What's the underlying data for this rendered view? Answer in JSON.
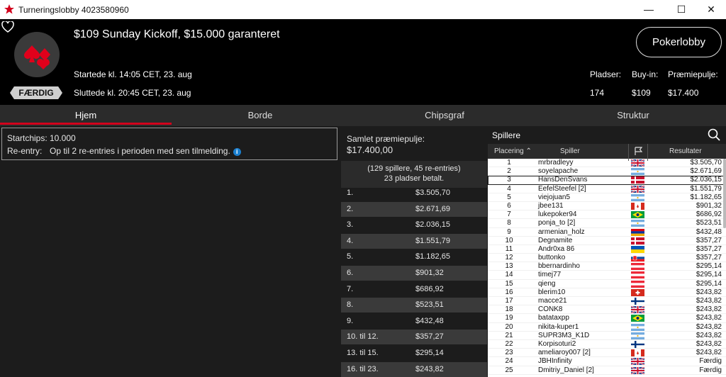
{
  "window": {
    "title": "Turneringslobby 4023580960"
  },
  "header": {
    "tournament_name": "$109 Sunday Kickoff, $15.000 garanteret",
    "status_badge": "FÆRDIG",
    "started": "Startede kl. 14:05 CET, 23. aug",
    "ended": "Sluttede kl. 20:45 CET, 23. aug",
    "pokerlobby_button": "Pokerlobby",
    "stats": {
      "seats_label": "Pladser:",
      "seats_value": "174",
      "buyin_label": "Buy-in:",
      "buyin_value": "$109",
      "prizepool_label": "Præmiepulje:",
      "prizepool_value": "$17.400"
    }
  },
  "tabs": [
    {
      "label": "Hjem"
    },
    {
      "label": "Borde"
    },
    {
      "label": "Chipsgraf"
    },
    {
      "label": "Struktur"
    }
  ],
  "info": {
    "startchips_label": "Startchips:",
    "startchips_value": "10.000",
    "reentry_label": "Re-entry:",
    "reentry_value": "Op til 2 re-entries i perioden med sen tilmelding."
  },
  "prizes": {
    "title_line1": "Samlet præmiepulje:",
    "title_line2": "$17.400,00",
    "summary_line1": "(129 spillere, 45 re-entries)",
    "summary_line2": "23 pladser betalt.",
    "rows": [
      {
        "place": "1.",
        "amount": "$3.505,70"
      },
      {
        "place": "2.",
        "amount": "$2.671,69"
      },
      {
        "place": "3.",
        "amount": "$2.036,15"
      },
      {
        "place": "4.",
        "amount": "$1.551,79"
      },
      {
        "place": "5.",
        "amount": "$1.182,65"
      },
      {
        "place": "6.",
        "amount": "$901,32"
      },
      {
        "place": "7.",
        "amount": "$686,92"
      },
      {
        "place": "8.",
        "amount": "$523,51"
      },
      {
        "place": "9.",
        "amount": "$432,48"
      },
      {
        "place": "10. til 12.",
        "amount": "$357,27"
      },
      {
        "place": "13. til 15.",
        "amount": "$295,14"
      },
      {
        "place": "16. til 23.",
        "amount": "$243,82"
      }
    ]
  },
  "players": {
    "title": "Spillere",
    "col_place": "Placering",
    "col_player": "Spiller",
    "col_result": "Resultater",
    "rows": [
      {
        "rank": "1",
        "name": "mrbradleyy",
        "flag": "gb",
        "result": "$3.505,70"
      },
      {
        "rank": "2",
        "name": "soyelapache",
        "flag": "ar",
        "result": "$2.671,69"
      },
      {
        "rank": "3",
        "name": "HansDenSvans",
        "flag": "dk",
        "result": "$2.036,15"
      },
      {
        "rank": "4",
        "name": "EefelSteefel [2]",
        "flag": "gb",
        "result": "$1.551,79"
      },
      {
        "rank": "5",
        "name": "viejojuan5",
        "flag": "ar",
        "result": "$1.182,65"
      },
      {
        "rank": "6",
        "name": "jbee131",
        "flag": "ca",
        "result": "$901,32"
      },
      {
        "rank": "7",
        "name": "lukepoker94",
        "flag": "br",
        "result": "$686,92"
      },
      {
        "rank": "8",
        "name": "ponja_to [2]",
        "flag": "ar",
        "result": "$523,51"
      },
      {
        "rank": "9",
        "name": "armenian_holz",
        "flag": "am",
        "result": "$432,48"
      },
      {
        "rank": "10",
        "name": "Degnamite",
        "flag": "dk",
        "result": "$357,27"
      },
      {
        "rank": "11",
        "name": "Andr0xa 86",
        "flag": "ua",
        "result": "$357,27"
      },
      {
        "rank": "12",
        "name": "buttonko",
        "flag": "sk",
        "result": "$357,27"
      },
      {
        "rank": "13",
        "name": "bbernardinho",
        "flag": "at",
        "result": "$295,14"
      },
      {
        "rank": "14",
        "name": "timej77",
        "flag": "at",
        "result": "$295,14"
      },
      {
        "rank": "15",
        "name": "qieng",
        "flag": "at",
        "result": "$295,14"
      },
      {
        "rank": "16",
        "name": "blerim10",
        "flag": "ch",
        "result": "$243,82"
      },
      {
        "rank": "17",
        "name": "macce21",
        "flag": "fi",
        "result": "$243,82"
      },
      {
        "rank": "18",
        "name": "CONK8",
        "flag": "gb",
        "result": "$243,82"
      },
      {
        "rank": "19",
        "name": "batataxpp",
        "flag": "br",
        "result": "$243,82"
      },
      {
        "rank": "20",
        "name": "nikita-kuper1",
        "flag": "ar",
        "result": "$243,82"
      },
      {
        "rank": "21",
        "name": "SUPR3M3_K1D",
        "flag": "ar",
        "result": "$243,82"
      },
      {
        "rank": "22",
        "name": "Korpisoturi2",
        "flag": "fi",
        "result": "$243,82"
      },
      {
        "rank": "23",
        "name": "ameliaroy007 [2]",
        "flag": "ca",
        "result": "$243,82"
      },
      {
        "rank": "24",
        "name": "JBHInfinity",
        "flag": "gb",
        "result": "Færdig"
      },
      {
        "rank": "25",
        "name": "Dmitriy_Daniel [2]",
        "flag": "gb",
        "result": "Færdig"
      }
    ]
  },
  "colors": {
    "accent": "#d2001c",
    "header_bg": "#000000",
    "panel_bg": "#1c1c1c",
    "tab_bg": "#2b2b2b",
    "info_icon": "#1a7fcf"
  }
}
